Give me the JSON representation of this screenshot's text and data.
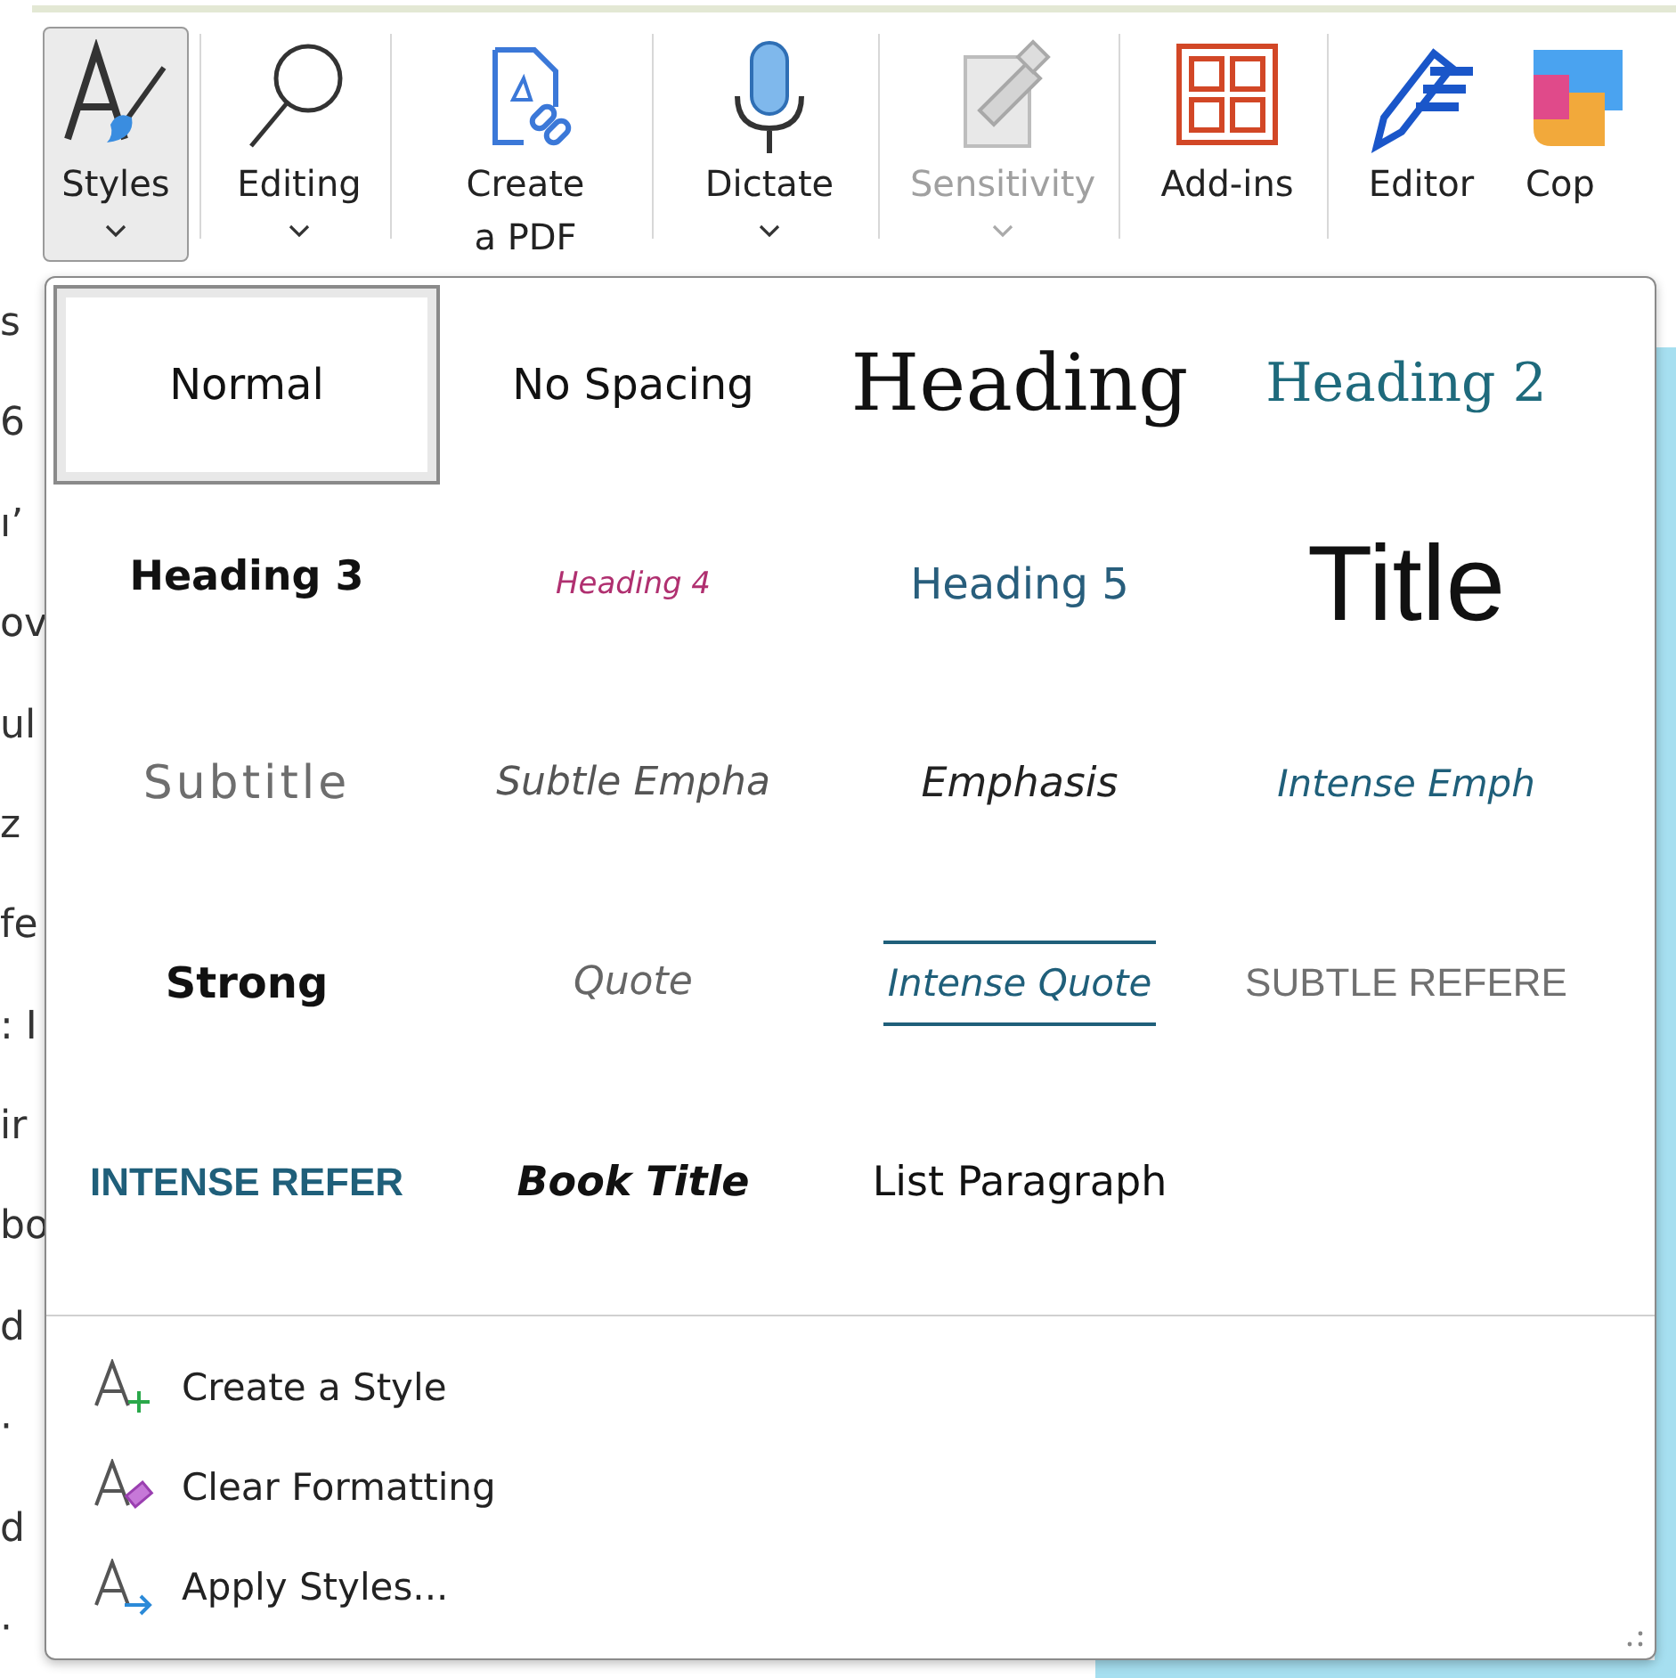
{
  "ribbon": [
    {
      "kind": "styles",
      "label": "Styles",
      "caret": true,
      "pressed": true,
      "disabled": false
    },
    {
      "kind": "editing",
      "label": "Editing",
      "caret": true,
      "pressed": false,
      "disabled": false
    },
    {
      "kind": "pdf",
      "label": "Create\na PDF",
      "pressed": false,
      "disabled": false
    },
    {
      "kind": "dictate",
      "label": "Dictate",
      "caret": true,
      "pressed": false,
      "disabled": false
    },
    {
      "kind": "sensitivity",
      "label": "Sensitivity",
      "caret": true,
      "pressed": false,
      "disabled": true
    },
    {
      "kind": "addins",
      "label": "Add-ins",
      "pressed": false,
      "disabled": false
    },
    {
      "kind": "editor",
      "label": "Editor",
      "pressed": false,
      "disabled": false
    },
    {
      "kind": "copilot",
      "label": "Cop",
      "pressed": false,
      "disabled": false
    }
  ],
  "document_fragments": [
    "s",
    "6",
    "ı’",
    "ov",
    "ul",
    "z",
    "fe",
    ": I",
    "ir",
    "bo",
    "d",
    "·",
    "d",
    "·"
  ],
  "styles_gallery": [
    {
      "kind": "normal",
      "label": "Normal",
      "selected": true
    },
    {
      "kind": "no-spacing",
      "label": "No Spacing",
      "selected": false
    },
    {
      "kind": "heading1",
      "label": "Heading",
      "selected": false
    },
    {
      "kind": "heading2",
      "label": "Heading 2",
      "selected": false
    },
    {
      "kind": "heading3",
      "label": "Heading 3",
      "selected": false
    },
    {
      "kind": "heading4",
      "label": "Heading 4",
      "selected": false
    },
    {
      "kind": "heading5",
      "label": "Heading 5",
      "selected": false
    },
    {
      "kind": "title",
      "label": "Title",
      "selected": false
    },
    {
      "kind": "subtitle",
      "label": "Subtitle",
      "selected": false
    },
    {
      "kind": "subtle-emphasis",
      "label": "Subtle Empha",
      "selected": false
    },
    {
      "kind": "emphasis",
      "label": "Emphasis",
      "selected": false
    },
    {
      "kind": "intense-emphasis",
      "label": "Intense Emph",
      "selected": false
    },
    {
      "kind": "strong",
      "label": "Strong",
      "selected": false
    },
    {
      "kind": "quote",
      "label": "Quote",
      "selected": false
    },
    {
      "kind": "intense-quote",
      "label": "Intense Quote",
      "selected": false
    },
    {
      "kind": "subtle-reference",
      "label": "SUBTLE REFERE",
      "selected": false
    },
    {
      "kind": "intense-reference",
      "label": "INTENSE REFER",
      "selected": false
    },
    {
      "kind": "book-title",
      "label": "Book Title",
      "selected": false
    },
    {
      "kind": "list-paragraph",
      "label": "List Paragraph",
      "selected": false
    }
  ],
  "menu": [
    {
      "kind": "create",
      "label": "Create a Style"
    },
    {
      "kind": "clear",
      "label": "Clear Formatting"
    },
    {
      "kind": "apply",
      "label": "Apply Styles..."
    }
  ]
}
